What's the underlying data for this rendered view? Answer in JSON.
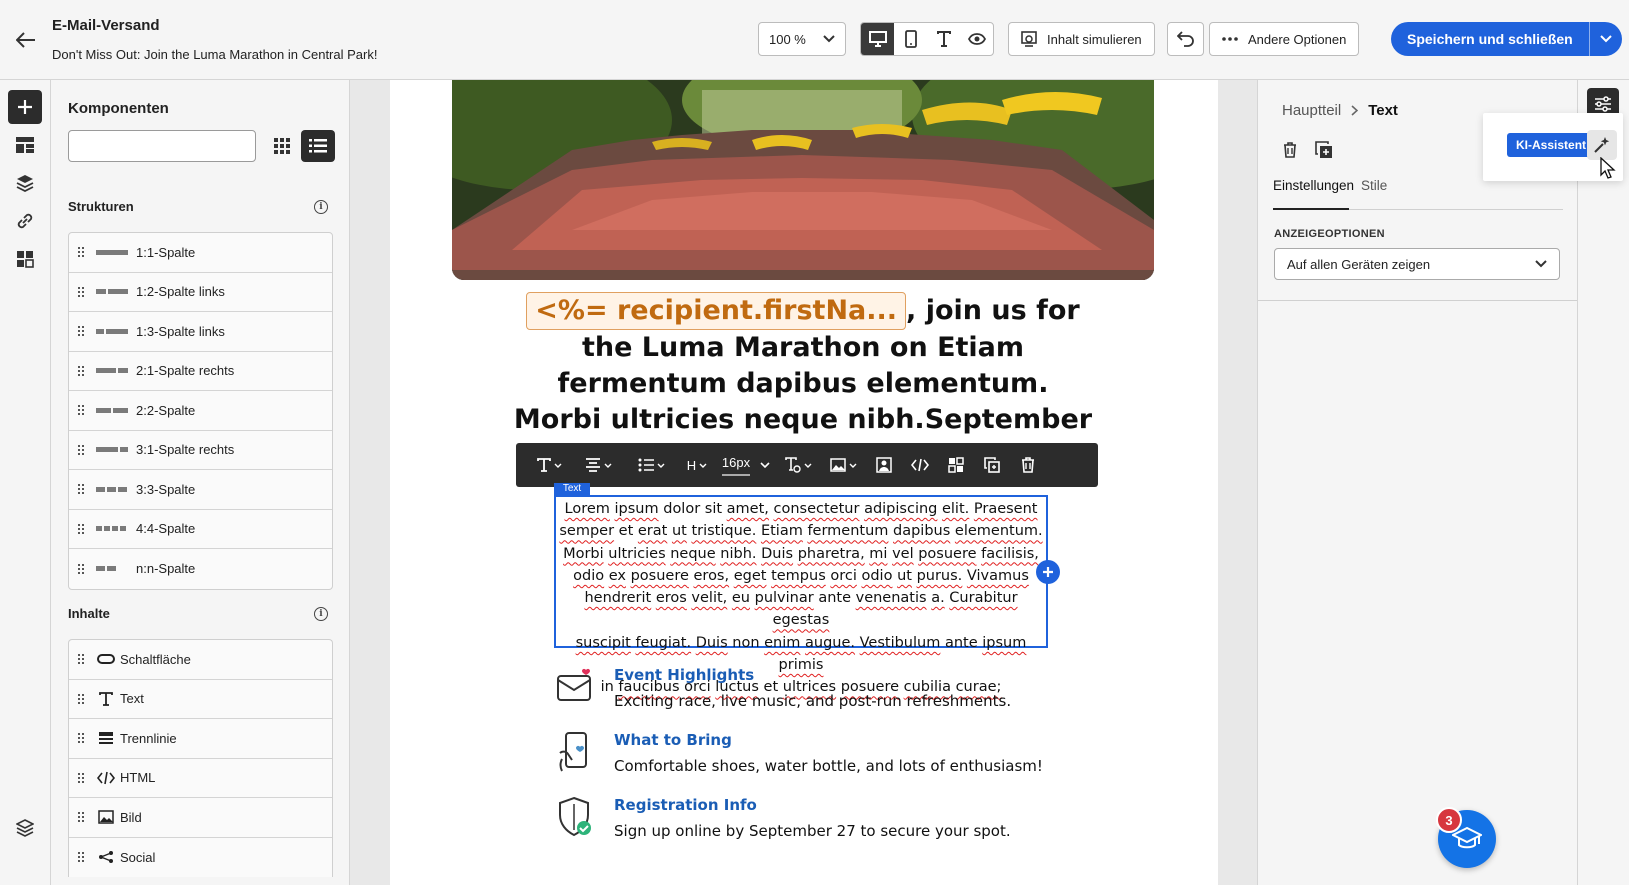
{
  "header": {
    "title": "E-Mail-Versand",
    "subtitle": "Don't Miss Out: Join the Luma Marathon in Central Park!",
    "zoom": "100 %",
    "simulate_label": "Inhalt simulieren",
    "more_options_label": "Andere Optionen",
    "save_label": "Speichern und schließen"
  },
  "components": {
    "title": "Komponenten",
    "search_placeholder": "",
    "structures_title": "Strukturen",
    "structures": [
      {
        "label": "1:1-Spalte",
        "cols": [
          32
        ]
      },
      {
        "label": "1:2-Spalte links",
        "cols": [
          10,
          20
        ]
      },
      {
        "label": "1:3-Spalte links",
        "cols": [
          8,
          22
        ]
      },
      {
        "label": "2:1-Spalte rechts",
        "cols": [
          20,
          10
        ]
      },
      {
        "label": "2:2-Spalte",
        "cols": [
          15,
          15
        ]
      },
      {
        "label": "3:1-Spalte rechts",
        "cols": [
          22,
          8
        ]
      },
      {
        "label": "3:3-Spalte",
        "cols": [
          9,
          9,
          9
        ]
      },
      {
        "label": "4:4-Spalte",
        "cols": [
          6,
          6,
          6,
          6
        ]
      },
      {
        "label": "n:n-Spalte",
        "cols": [
          9,
          9
        ]
      }
    ],
    "contents_title": "Inhalte",
    "contents": [
      {
        "label": "Schaltfläche",
        "icon": "button-icon"
      },
      {
        "label": "Text",
        "icon": "text-icon"
      },
      {
        "label": "Trennlinie",
        "icon": "divider-icon"
      },
      {
        "label": "HTML",
        "icon": "html-icon"
      },
      {
        "label": "Bild",
        "icon": "image-icon"
      },
      {
        "label": "Social",
        "icon": "social-icon"
      }
    ]
  },
  "email": {
    "token": "<%= recipient.firstNa...",
    "headline_rest": ", join us for",
    "headline_line2": "the Luma Marathon on Etiam",
    "headline_line3": "fermentum dapibus elementum.",
    "headline_line4": "Morbi ultricies neque nibh.September",
    "text_tag": "Text",
    "body_lines": [
      "Lorem ipsum dolor sit amet, consectetur adipiscing elit. Praesent",
      "semper et erat ut tristique. Etiam fermentum dapibus elementum.",
      "Morbi ultricies neque nibh. Duis pharetra, mi vel posuere facilisis,",
      "odio ex posuere eros, eget tempus orci odio ut purus. Vivamus",
      "hendrerit eros velit, eu pulvinar ante venenatis a. Curabitur egestas",
      "suscipit feugiat. Duis non enim augue. Vestibulum ante ipsum primis",
      "in faucibus orci luctus et ultrices posuere cubilia curae;"
    ],
    "features": [
      {
        "title": "Event Highlights",
        "desc": "Exciting race, live music, and post-run refreshments.",
        "icon": "mail-heart-icon"
      },
      {
        "title": "What to Bring",
        "desc": "Comfortable shoes, water bottle, and lots of enthusiasm!",
        "icon": "phone-hand-icon"
      },
      {
        "title": "Registration Info",
        "desc": "Sign up online by September 27 to secure your spot.",
        "icon": "shield-check-icon"
      }
    ]
  },
  "toolbar": {
    "font_size": "16px",
    "heading": "H"
  },
  "properties": {
    "crumb_parent": "Hauptteil",
    "crumb_current": "Text",
    "tab_settings": "Einstellungen",
    "tab_styles": "Stile",
    "display_section": "ANZEIGEOPTIONEN",
    "display_value": "Auf allen Geräten zeigen"
  },
  "ai": {
    "tooltip": "KI-Assistent"
  },
  "help": {
    "badge": "3"
  }
}
